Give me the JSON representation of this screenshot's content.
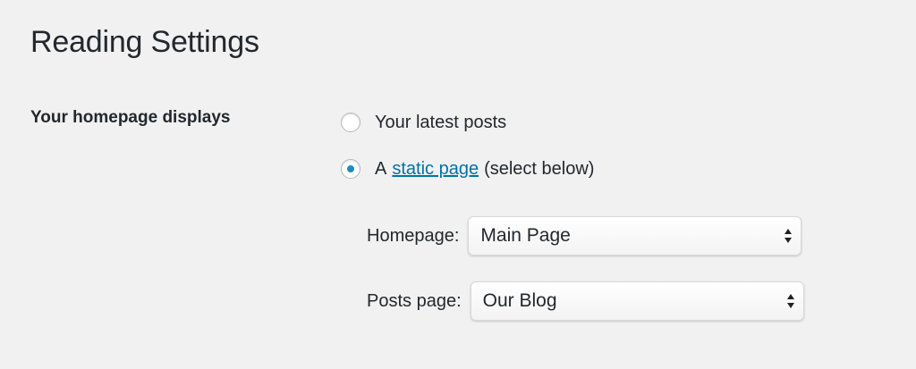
{
  "page": {
    "title": "Reading Settings"
  },
  "homepage_displays": {
    "label": "Your homepage displays",
    "options": [
      {
        "label": "Your latest posts",
        "selected": false
      },
      {
        "prefix": "A",
        "link_text": "static page",
        "suffix": "(select below)",
        "selected": true
      }
    ]
  },
  "homepage_select": {
    "label": "Homepage:",
    "value": "Main Page",
    "icon": "up-down-arrows-icon"
  },
  "posts_page_select": {
    "label": "Posts page:",
    "value": "Our Blog",
    "icon": "up-down-arrows-icon"
  },
  "colors": {
    "background": "#f1f1f1",
    "link": "#0073aa",
    "radio_selected": "#1e8cbe",
    "text": "#23282d"
  }
}
